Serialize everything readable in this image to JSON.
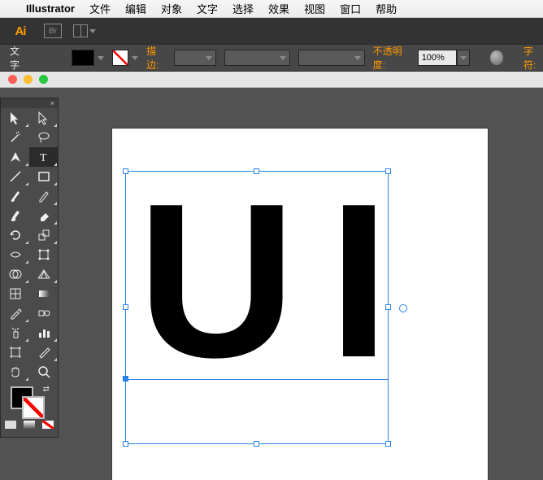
{
  "menu": {
    "app": "Illustrator",
    "items": [
      "文件",
      "编辑",
      "对象",
      "文字",
      "选择",
      "效果",
      "视图",
      "窗口",
      "帮助"
    ]
  },
  "appbar": {
    "logo": "Ai"
  },
  "controlbar": {
    "context": "文字",
    "stroke_label": "描边:",
    "opacity_label": "不透明度:",
    "opacity_value": "100%",
    "character_label": "字符:"
  },
  "canvas": {
    "text_content": "UI"
  },
  "icons": {
    "br": "Br"
  }
}
